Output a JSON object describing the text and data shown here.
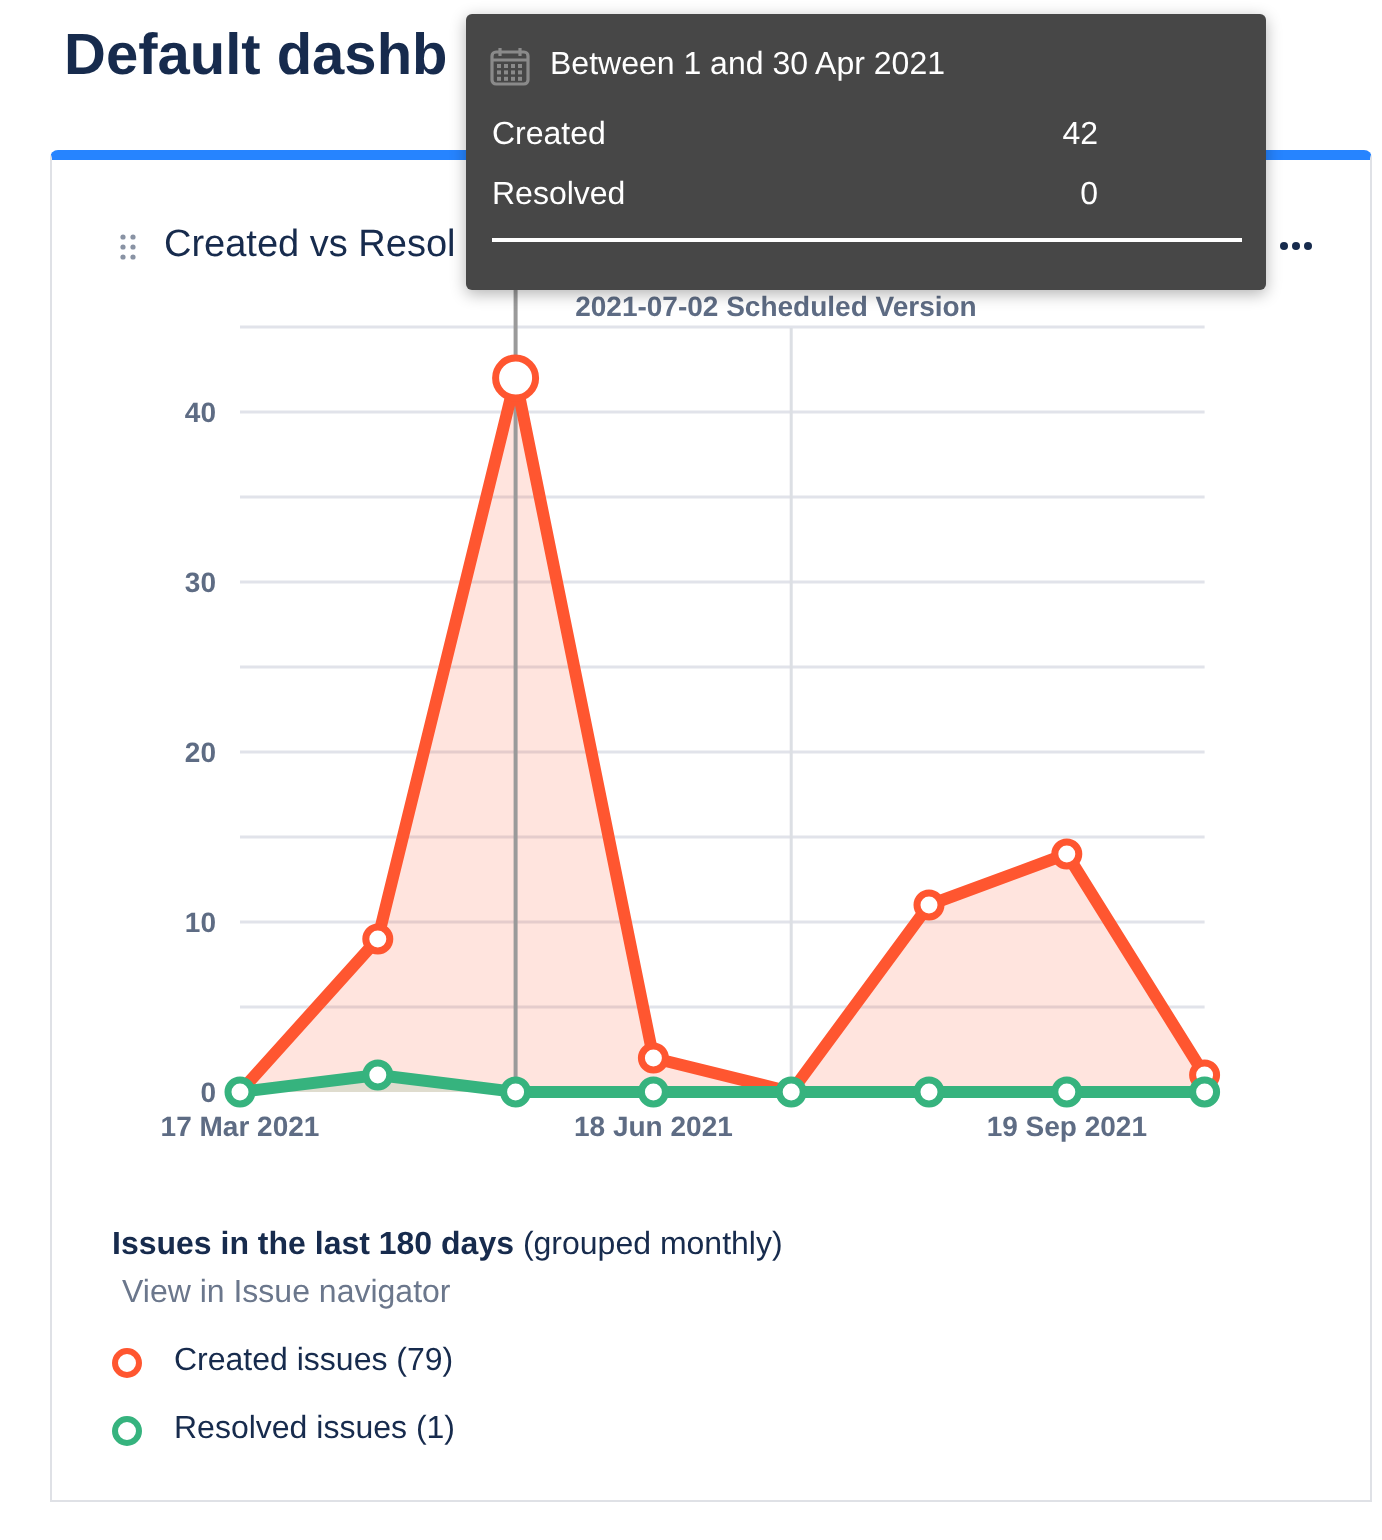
{
  "page_title": "Default dashb",
  "gadget": {
    "title": "Created vs Resol",
    "chart_data": {
      "type": "area",
      "categories": [
        "17 Mar 2021",
        null,
        null,
        "18 Jun 2021",
        null,
        null,
        "19 Sep 2021",
        null
      ],
      "ylim": [
        0,
        45
      ],
      "yticks": [
        0,
        10,
        20,
        30,
        40
      ],
      "series": [
        {
          "name": "Created issues",
          "color": "#ff5630",
          "values": [
            0,
            9,
            42,
            2,
            0,
            11,
            14,
            1
          ]
        },
        {
          "name": "Resolved issues",
          "color": "#36b37e",
          "values": [
            0,
            1,
            0,
            0,
            0,
            0,
            0,
            0
          ]
        }
      ],
      "grid": true,
      "annotations": [
        "2021-07-02 Scheduled Version"
      ]
    },
    "points": [
      {
        "selected": false
      },
      {
        "selected": false
      },
      {
        "selected": true
      },
      {
        "selected": false
      },
      {
        "selected": false
      },
      {
        "selected": false
      },
      {
        "selected": false
      },
      {
        "selected": false
      }
    ],
    "summary": "**Issues in the last 180 days** (grouped monthly)",
    "link": "View in Issue navigator",
    "legend_counts": [
      "(79)",
      "(1)"
    ]
  },
  "tooltip": {
    "title": "Between 1 and 30 Apr 2021",
    "rows": [
      {
        "label": "Created",
        "value": "42"
      },
      {
        "label": "Resolved",
        "value": "0"
      }
    ]
  }
}
